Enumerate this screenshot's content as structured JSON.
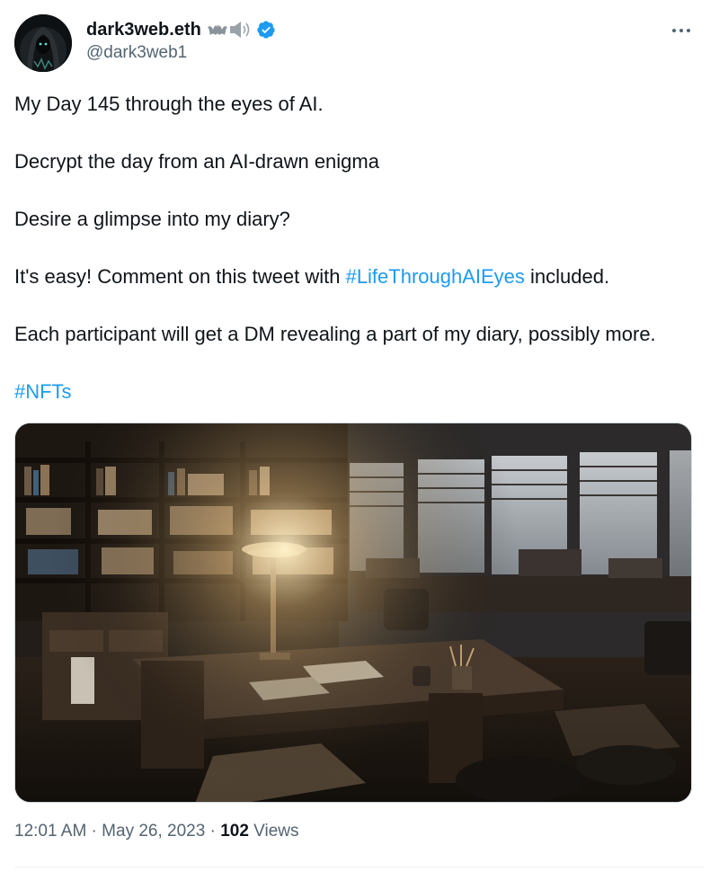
{
  "author": {
    "display_name": "dark3web.eth",
    "handle": "@dark3web1",
    "verified": true,
    "name_emoji": [
      "bat-emoji",
      "speaker-emoji"
    ]
  },
  "more_icon": "more-horizontal-icon",
  "tweet": {
    "line1": "My Day 145 through the eyes of AI.",
    "line2": "Decrypt the day from an AI-drawn enigma",
    "line3": "Desire a glimpse into my diary?",
    "line4_before": "It's easy! Comment on this tweet with ",
    "line4_hashtag": "#LifeThroughAIEyes",
    "line4_after": " included.",
    "line5": "Each participant will get a DM revealing a part of my diary, possibly more.",
    "hashtag2": "#NFTs"
  },
  "media": {
    "description_icon": "ai-generated-office-image"
  },
  "meta": {
    "time": "12:01 AM",
    "separator": " · ",
    "date": "May 26, 2023",
    "views_count": "102",
    "views_label": " Views"
  },
  "colors": {
    "text": "#0f1419",
    "secondary": "#536471",
    "link": "#1d9bf0"
  }
}
